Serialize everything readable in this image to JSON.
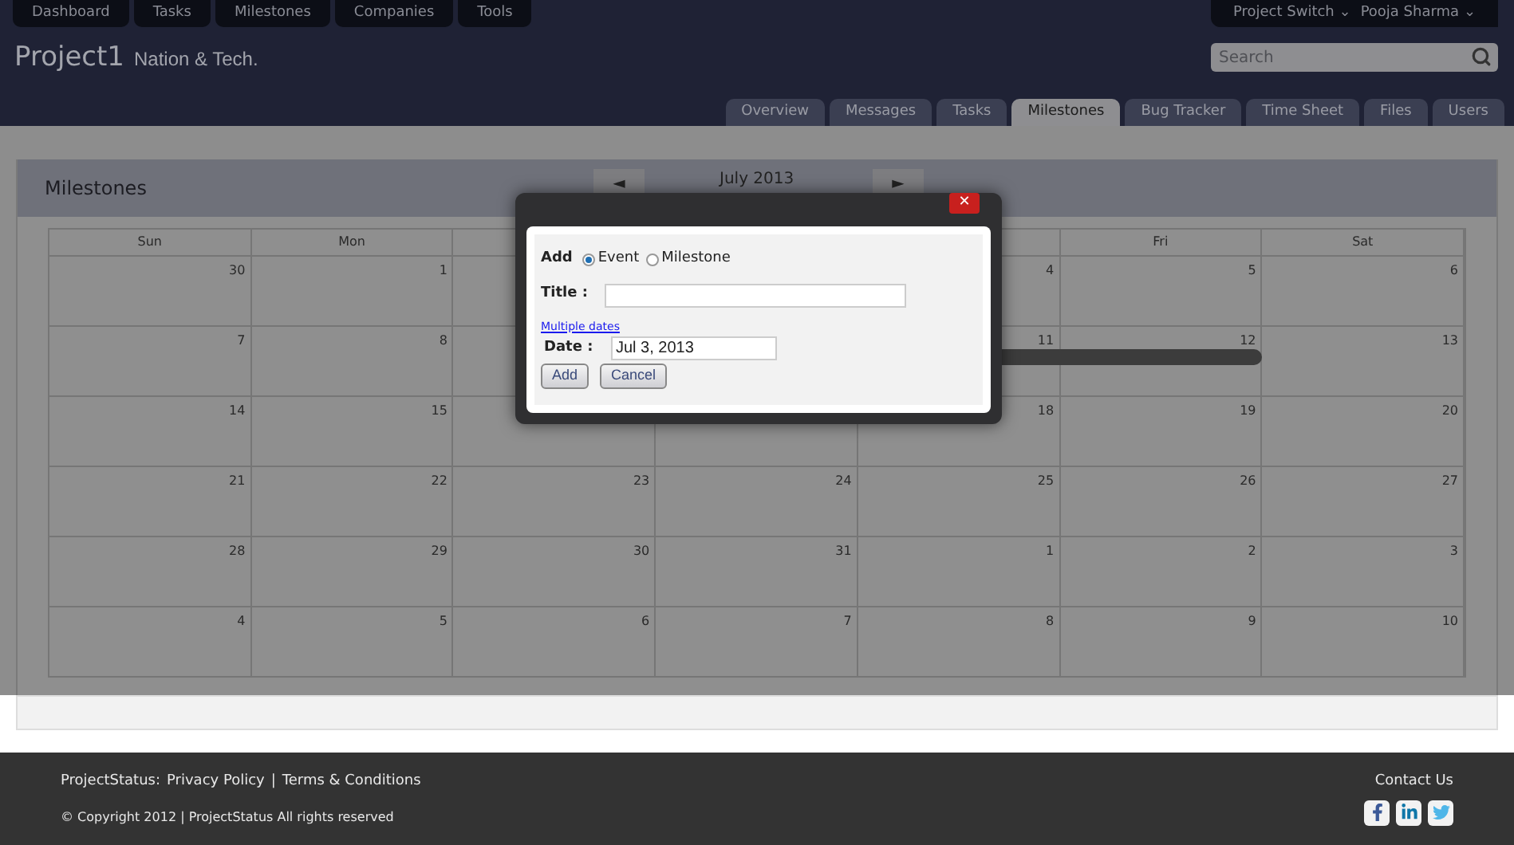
{
  "top_nav": [
    {
      "label": "Dashboard"
    },
    {
      "label": "Tasks"
    },
    {
      "label": "Milestones"
    },
    {
      "label": "Companies"
    },
    {
      "label": "Tools"
    }
  ],
  "user_menu": [
    {
      "label": "Project Switch",
      "icon": "⌄"
    },
    {
      "label": "Pooja Sharma",
      "icon": "⌄"
    }
  ],
  "project": {
    "name": "Project1",
    "company": "Nation & Tech."
  },
  "search": {
    "placeholder": "Search"
  },
  "tabs": [
    {
      "label": "Overview",
      "selected": false
    },
    {
      "label": "Messages",
      "selected": false
    },
    {
      "label": "Tasks",
      "selected": false
    },
    {
      "label": "Milestones",
      "selected": true
    },
    {
      "label": "Bug Tracker",
      "selected": false
    },
    {
      "label": "Time Sheet",
      "selected": false
    },
    {
      "label": "Files",
      "selected": false
    },
    {
      "label": "Users",
      "selected": false
    }
  ],
  "panel": {
    "title": "Milestones",
    "prev": "◄",
    "month": "July 2013",
    "next": "►"
  },
  "calendar": {
    "headers": {
      "start": [
        "Sun",
        "Mon"
      ],
      "end": [
        "Fri",
        "Sat"
      ]
    },
    "weeks": [
      {
        "start": [
          {
            "day": "30",
            "event": false
          },
          {
            "day": "1",
            "event": false
          }
        ],
        "end": [
          {
            "day": "4",
            "event": false
          },
          {
            "day": "5",
            "event": false
          },
          {
            "day": "6",
            "event": false
          }
        ]
      },
      {
        "start": [
          {
            "day": "7",
            "event": false
          },
          {
            "day": "8",
            "event": false
          }
        ],
        "end": [
          {
            "day": "11",
            "event": true
          },
          {
            "day": "12",
            "event": true
          },
          {
            "day": "13",
            "event": false
          }
        ]
      },
      {
        "start": [
          {
            "day": "14",
            "event": false
          },
          {
            "day": "15",
            "event": false
          }
        ],
        "end": [
          {
            "day": "18",
            "event": false
          },
          {
            "day": "19",
            "event": false
          },
          {
            "day": "20",
            "event": false
          }
        ]
      },
      {
        "start": [
          {
            "day": "21",
            "event": false
          },
          {
            "day": "22",
            "event": false
          },
          {
            "day": "23",
            "event": false
          },
          {
            "day": "24",
            "event": false
          },
          {
            "day": "25",
            "event": false
          },
          {
            "day": "26",
            "event": false
          },
          {
            "day": "27",
            "event": false
          }
        ]
      },
      {
        "start": [
          {
            "day": "28",
            "event": false
          },
          {
            "day": "29",
            "event": false
          },
          {
            "day": "30",
            "event": false
          },
          {
            "day": "31",
            "event": false
          },
          {
            "day": "1",
            "event": false
          },
          {
            "day": "2",
            "event": false
          },
          {
            "day": "3",
            "event": false
          }
        ]
      },
      {
        "start": [
          {
            "day": "4",
            "event": false
          },
          {
            "day": "5",
            "event": false
          },
          {
            "day": "6",
            "event": false
          },
          {
            "day": "7",
            "event": false
          },
          {
            "day": "8",
            "event": false
          },
          {
            "day": "9",
            "event": false
          },
          {
            "day": "10",
            "event": false
          }
        ]
      }
    ]
  },
  "dialog": {
    "close": "✕",
    "add_label": "Add",
    "types": [
      {
        "label": "Event",
        "selected": true
      },
      {
        "label": "Milestone",
        "selected": false
      }
    ],
    "title_label": "Title :",
    "multiple_dates": "Multiple dates",
    "date_label": "Date :",
    "date_value": "Jul 3, 2013",
    "buttons": [
      "Add",
      "Cancel"
    ]
  },
  "footer": {
    "links_prefix": "ProjectStatus:",
    "links": [
      "Privacy Policy",
      "Terms & Conditions"
    ],
    "separator": "|",
    "copyright": "© Copyright 2012 | ProjectStatus All rights reserved",
    "contact": "Contact Us"
  }
}
